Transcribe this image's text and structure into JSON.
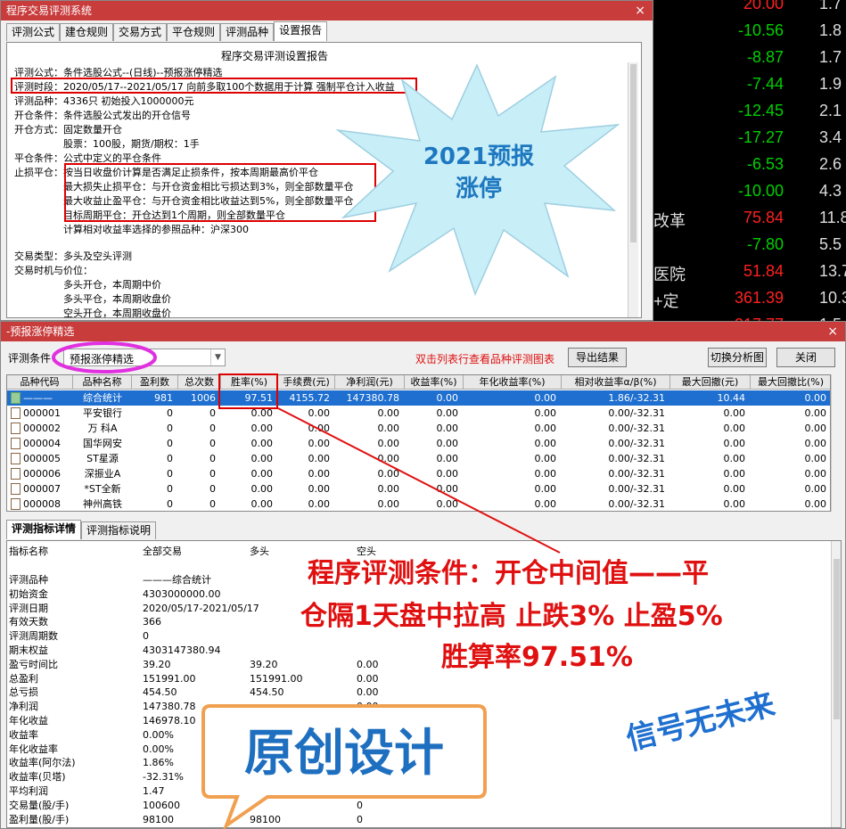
{
  "win1": {
    "title": "程序交易评测系统",
    "close": "×",
    "tabs": [
      "评测公式",
      "建仓规则",
      "交易方式",
      "平仓规则",
      "评测品种",
      "设置报告"
    ],
    "report": {
      "heading": "程序交易评测设置报告",
      "lines": [
        "评测公式：条件选股公式--(日线)--预报涨停精选",
        "评测时段：2020/05/17--2021/05/17 向前多取100个数据用于计算 强制平仓计入收益",
        "评测品种：4336只 初始投入1000000元",
        "开仓条件：条件选股公式发出的开仓信号",
        "开仓方式：固定数量开仓",
        "　　　　　股票：100股，期货/期权：1手",
        "平仓条件：公式中定义的平仓条件",
        "止损平仓：按当日收盘价计算是否满足止损条件，按本周期最高价平仓",
        "　　　　　最大损失止损平仓：与开仓资金相比亏损达到3%，则全部数量平仓",
        "　　　　　最大收益止盈平仓：与开仓资金相比收益达到5%，则全部数量平仓",
        "　　　　　目标周期平仓：开仓达到1个周期，则全部数量平仓",
        "　　　　　计算相对收益率选择的参照品种：沪深300",
        "交易类型：多头及空头评测",
        "交易时机与价位：",
        "　　　　　多头开仓，本周期中价",
        "　　　　　多头平仓，本周期收盘价",
        "　　　　　空头开仓，本周期收盘价"
      ]
    }
  },
  "right_panel": {
    "col1": [
      "20.00",
      "-10.56",
      "-8.87",
      "-7.44",
      "-12.45",
      "-17.27",
      "-6.53",
      "-10.00",
      "75.84",
      "-7.80",
      "51.84",
      "361.39",
      "317.77"
    ],
    "col2": [
      "1.7",
      "1.8",
      "1.7",
      "1.9",
      "2.1",
      "3.4",
      "2.6",
      "4.3",
      "11.8",
      "5.5",
      "13.7",
      "10.3",
      "1.5"
    ],
    "labels": {
      "8": "改革",
      "10": "医院",
      "11": "+定"
    }
  },
  "burst_text": [
    "2021预报",
    "涨停"
  ],
  "win2": {
    "title": "-预报涨停精选",
    "close": "×",
    "condition_label": "评测条件",
    "condition_value": "预报涨停精选",
    "hint": "双击列表行查看品种评测图表",
    "buttons": {
      "export": "导出结果",
      "switch": "切换分析图",
      "close": "关闭"
    },
    "columns": [
      "品种代码",
      "品种名称",
      "盈利数",
      "总次数",
      "胜率(%)",
      "手续费(元)",
      "净利润(元)",
      "收益率(%)",
      "年化收益率(%)",
      "相对收益率α/β(%)",
      "最大回撤(元)",
      "最大回撤比(%)"
    ],
    "rows": [
      [
        "———",
        "综合统计",
        "981",
        "1006",
        "97.51",
        "4155.72",
        "147380.78",
        "0.00",
        "0.00",
        "1.86/-32.31",
        "10.44",
        "0.00"
      ],
      [
        "000001",
        "平安银行",
        "0",
        "0",
        "0.00",
        "0.00",
        "0.00",
        "0.00",
        "0.00",
        "0.00/-32.31",
        "0.00",
        "0.00"
      ],
      [
        "000002",
        "万 科A",
        "0",
        "0",
        "0.00",
        "0.00",
        "0.00",
        "0.00",
        "0.00",
        "0.00/-32.31",
        "0.00",
        "0.00"
      ],
      [
        "000004",
        "国华网安",
        "0",
        "0",
        "0.00",
        "0.00",
        "0.00",
        "0.00",
        "0.00",
        "0.00/-32.31",
        "0.00",
        "0.00"
      ],
      [
        "000005",
        "ST星源",
        "0",
        "0",
        "0.00",
        "0.00",
        "0.00",
        "0.00",
        "0.00",
        "0.00/-32.31",
        "0.00",
        "0.00"
      ],
      [
        "000006",
        "深振业A",
        "0",
        "0",
        "0.00",
        "0.00",
        "0.00",
        "0.00",
        "0.00",
        "0.00/-32.31",
        "0.00",
        "0.00"
      ],
      [
        "000007",
        "*ST全新",
        "0",
        "0",
        "0.00",
        "0.00",
        "0.00",
        "0.00",
        "0.00",
        "0.00/-32.31",
        "0.00",
        "0.00"
      ],
      [
        "000008",
        "神州高铁",
        "0",
        "0",
        "0.00",
        "0.00",
        "0.00",
        "0.00",
        "0.00",
        "0.00/-32.31",
        "0.00",
        "0.00"
      ]
    ],
    "bottom_tabs": [
      "评测指标详情",
      "评测指标说明"
    ],
    "detail_headers": [
      "指标名称",
      "全部交易",
      "多头",
      "空头"
    ],
    "detail_rows": [
      [
        "评测品种",
        "———综合统计",
        "",
        ""
      ],
      [
        "初始资金",
        "4303000000.00",
        "",
        ""
      ],
      [
        "评测日期",
        "2020/05/17-2021/05/17",
        "",
        ""
      ],
      [
        "有效天数",
        "366",
        "",
        ""
      ],
      [
        "评测周期数",
        "0",
        "",
        ""
      ],
      [
        "期末权益",
        "4303147380.94",
        "",
        ""
      ],
      [
        "盈亏时间比",
        "39.20",
        "39.20",
        "0.00"
      ],
      [
        "总盈利",
        "151991.00",
        "151991.00",
        "0.00"
      ],
      [
        "总亏损",
        "454.50",
        "454.50",
        "0.00"
      ],
      [
        "净利润",
        "147380.78",
        "",
        "0.00"
      ],
      [
        "年化收益",
        "146978.10",
        "",
        "0.00"
      ],
      [
        "收益率",
        "0.00%",
        "",
        "0.00%"
      ],
      [
        "年化收益率",
        "0.00%",
        "",
        "0.00%"
      ],
      [
        "收益率(阿尔法)",
        "1.86%",
        "",
        ""
      ],
      [
        "收益率(贝塔)",
        "-32.31%",
        "",
        ""
      ],
      [
        "平均利润",
        "1.47",
        "",
        ""
      ],
      [
        "交易量(股/手)",
        "100600",
        "",
        "0"
      ],
      [
        "盈利量(股/手)",
        "98100",
        "98100",
        "0"
      ]
    ]
  },
  "annotations": {
    "main": [
      "程序评测条件：开仓中间值——平",
      "仓隔1天盘中拉高 止跌3%  止盈5%",
      "胜算率97.51%"
    ],
    "original": "原创设计",
    "signal": "信号无未来"
  }
}
